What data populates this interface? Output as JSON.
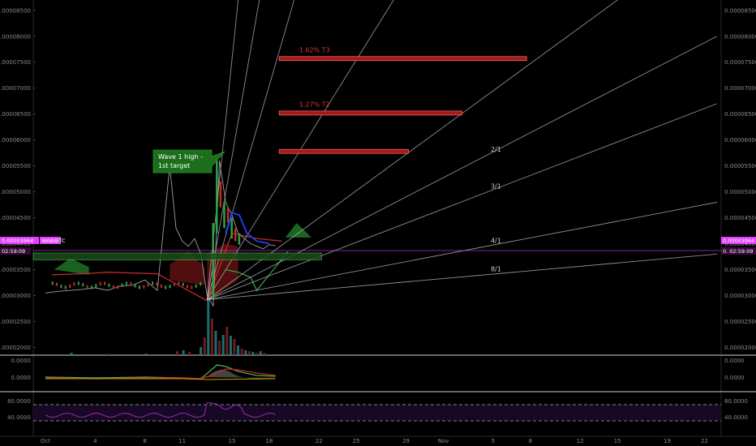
{
  "chart_data": {
    "type": "line",
    "symbol": "WABIBTC",
    "price_scale_left": [
      "0.00008500",
      "0.00008000",
      "0.00007500",
      "0.00007000",
      "0.00006500",
      "0.00006000",
      "0.00005500",
      "0.00005000",
      "0.00004500",
      "0.00004000",
      "0.00003500",
      "0.00003000",
      "0.00002500",
      "0.00002000"
    ],
    "price_scale_right": [
      "0.00008500",
      "0.00008000",
      "0.00007500",
      "0.00007000",
      "0.00006500",
      "0.00006000",
      "0.00005500",
      "0.00005000",
      "0.00004500",
      "0.00004000",
      "0.00003500",
      "0.00003000",
      "0.00002500",
      "0.00002000"
    ],
    "ylim": [
      1.85e-05,
      8.7e-05
    ],
    "current_price_label": "0.00003964",
    "right_price_label": "0.00003964",
    "countdown_left": "02:59:09",
    "countdown_right": "0.",
    "countdown_right_time": "02:59:09",
    "date_labels": [
      {
        "label": "Oct",
        "day": 0
      },
      {
        "label": "4",
        "day": 4
      },
      {
        "label": "8",
        "day": 8
      },
      {
        "label": "11",
        "day": 11
      },
      {
        "label": "15",
        "day": 15
      },
      {
        "label": "18",
        "day": 18
      },
      {
        "label": "22",
        "day": 22
      },
      {
        "label": "25",
        "day": 25
      },
      {
        "label": "29",
        "day": 29
      },
      {
        "label": "Nov",
        "day": 32
      },
      {
        "label": "5",
        "day": 36
      },
      {
        "label": "8",
        "day": 39
      },
      {
        "label": "12",
        "day": 43
      },
      {
        "label": "15",
        "day": 46
      },
      {
        "label": "19",
        "day": 50
      },
      {
        "label": "22",
        "day": 53
      }
    ],
    "price_line": {
      "days": [
        0,
        1,
        2,
        3,
        4,
        5,
        6,
        7,
        8,
        9,
        10,
        10.5,
        11,
        11.5,
        12,
        12.5,
        13,
        13.5,
        14,
        14.5,
        15,
        15.5,
        16,
        16.5,
        17,
        17.5,
        18,
        18.5
      ],
      "values": [
        3.05e-05,
        3.08e-05,
        3.1e-05,
        3.12e-05,
        3.15e-05,
        3.1e-05,
        3.18e-05,
        3.2e-05,
        3.3e-05,
        3.1e-05,
        5.5e-05,
        4.3e-05,
        4.05e-05,
        3.95e-05,
        4.1e-05,
        3.8e-05,
        3e-05,
        2.8e-05,
        5.6e-05,
        4.8e-05,
        4.55e-05,
        4.2e-05,
        4.1e-05,
        4e-05,
        3.95e-05,
        3.9e-05,
        3.98e-05,
        3.96e-05
      ]
    },
    "fib_levels": [
      {
        "label": "1.62% T3",
        "price": 7.57e-05
      },
      {
        "label": "1.27% T2",
        "price": 6.52e-05
      },
      {
        "label": "",
        "price": 5.78e-05
      }
    ],
    "support_zone": {
      "price_top": 3.82e-05,
      "price_bottom": 3.69e-05
    },
    "fan_origin": {
      "day": 13.0,
      "price": 2.92e-05
    },
    "fan_lines": [
      {
        "label": "",
        "target_day": 15.5,
        "target_price": 8.7e-05
      },
      {
        "label": "",
        "target_day": 17.2,
        "target_price": 8.7e-05
      },
      {
        "label": "",
        "target_day": 20.0,
        "target_price": 8.7e-05
      },
      {
        "label": "",
        "target_day": 28.0,
        "target_price": 8.7e-05
      },
      {
        "label": "",
        "target_day": 46.0,
        "target_price": 8.7e-05
      },
      {
        "label": "2/1",
        "target_day": 54.0,
        "target_price": 8e-05
      },
      {
        "label": "3/1",
        "target_day": 54.0,
        "target_price": 6.7e-05
      },
      {
        "label": "4/1",
        "target_day": 54.0,
        "target_price": 4.8e-05
      },
      {
        "label": "8/1",
        "target_day": 54.0,
        "target_price": 3.8e-05
      }
    ],
    "annotation": {
      "line1": "Wave 1 high -",
      "line2": "1st target"
    },
    "macd": {
      "scale": [
        "0.0000",
        "0.0000"
      ]
    },
    "rsi": {
      "scale": [
        "80.0000",
        "40.0000"
      ],
      "upper": 80,
      "lower": 30
    }
  },
  "colors": {
    "background": "#000000",
    "bull": "#2ea043",
    "bear": "#c62828",
    "magenta": "#e040fb",
    "blue": "#1e40ff",
    "fib": "#d63a3a"
  }
}
